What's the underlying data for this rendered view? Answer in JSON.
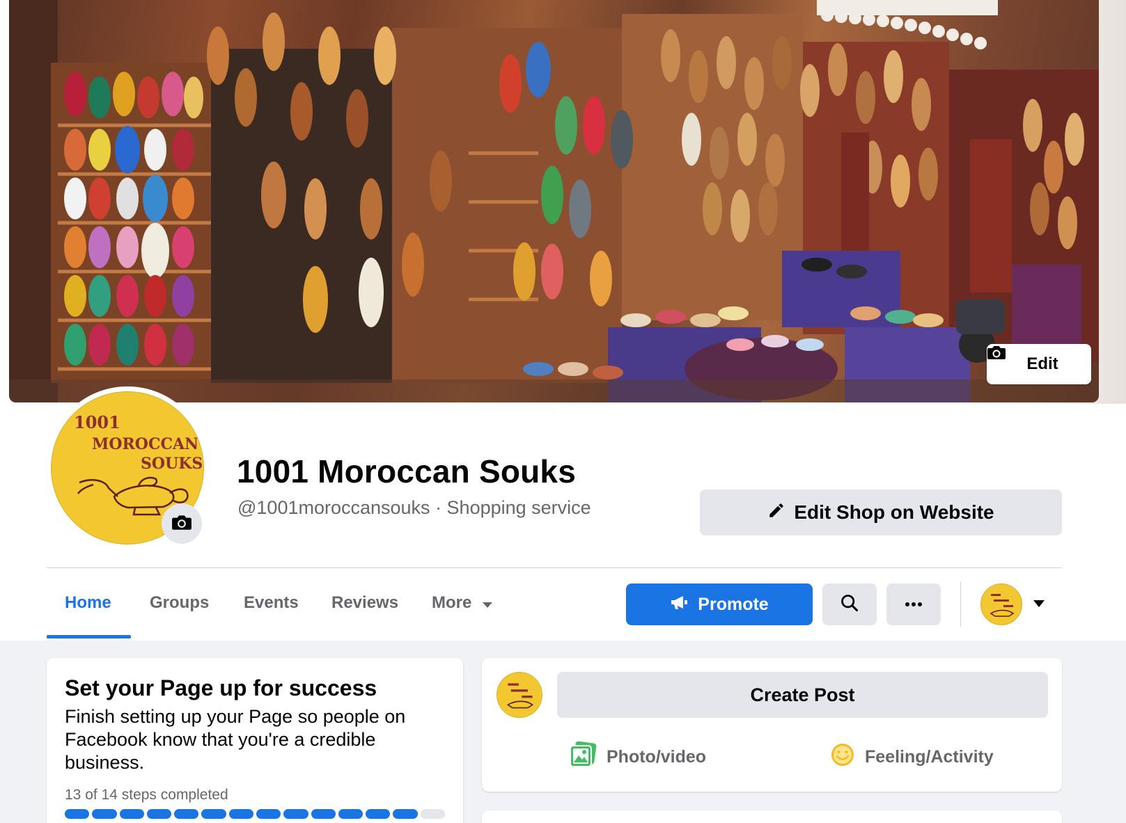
{
  "cover": {
    "edit_label": "Edit",
    "icons": {
      "edit": "camera-icon"
    }
  },
  "profile": {
    "avatar_text": [
      "1001",
      "MOROCCAN",
      "SOUKS"
    ],
    "name": "1001 Moroccan Souks",
    "subtitle": "@1001moroccansouks · Shopping service",
    "edit_shop_label": "Edit Shop on Website",
    "icons": {
      "avatar_camera": "camera-icon",
      "edit_shop": "pencil-icon"
    }
  },
  "nav": {
    "tabs": [
      {
        "label": "Home",
        "active": true
      },
      {
        "label": "Groups",
        "active": false
      },
      {
        "label": "Events",
        "active": false
      },
      {
        "label": "Reviews",
        "active": false
      },
      {
        "label": "More",
        "active": false
      }
    ],
    "promote_label": "Promote",
    "icons": {
      "promote": "megaphone-icon",
      "search": "search-icon",
      "more": "ellipsis-icon",
      "account_menu": "caret-down-icon"
    }
  },
  "setup": {
    "title": "Set your Page up for success",
    "description": "Finish setting up your Page so people on Facebook know that you're a credible business.",
    "progress_text": "13 of 14 steps completed",
    "steps_completed": 13,
    "steps_total": 14
  },
  "composer": {
    "create_post_label": "Create Post",
    "actions": [
      {
        "label": "Photo/video",
        "icon": "photo-icon"
      },
      {
        "label": "Feeling/Activity",
        "icon": "smiley-icon"
      }
    ]
  },
  "colors": {
    "accent": "#1b74e4",
    "avatar_yellow": "#f2c72f",
    "logo_text": "#8b2f2f",
    "button_gray": "#e4e6eb",
    "secondary_text": "#65676b"
  }
}
